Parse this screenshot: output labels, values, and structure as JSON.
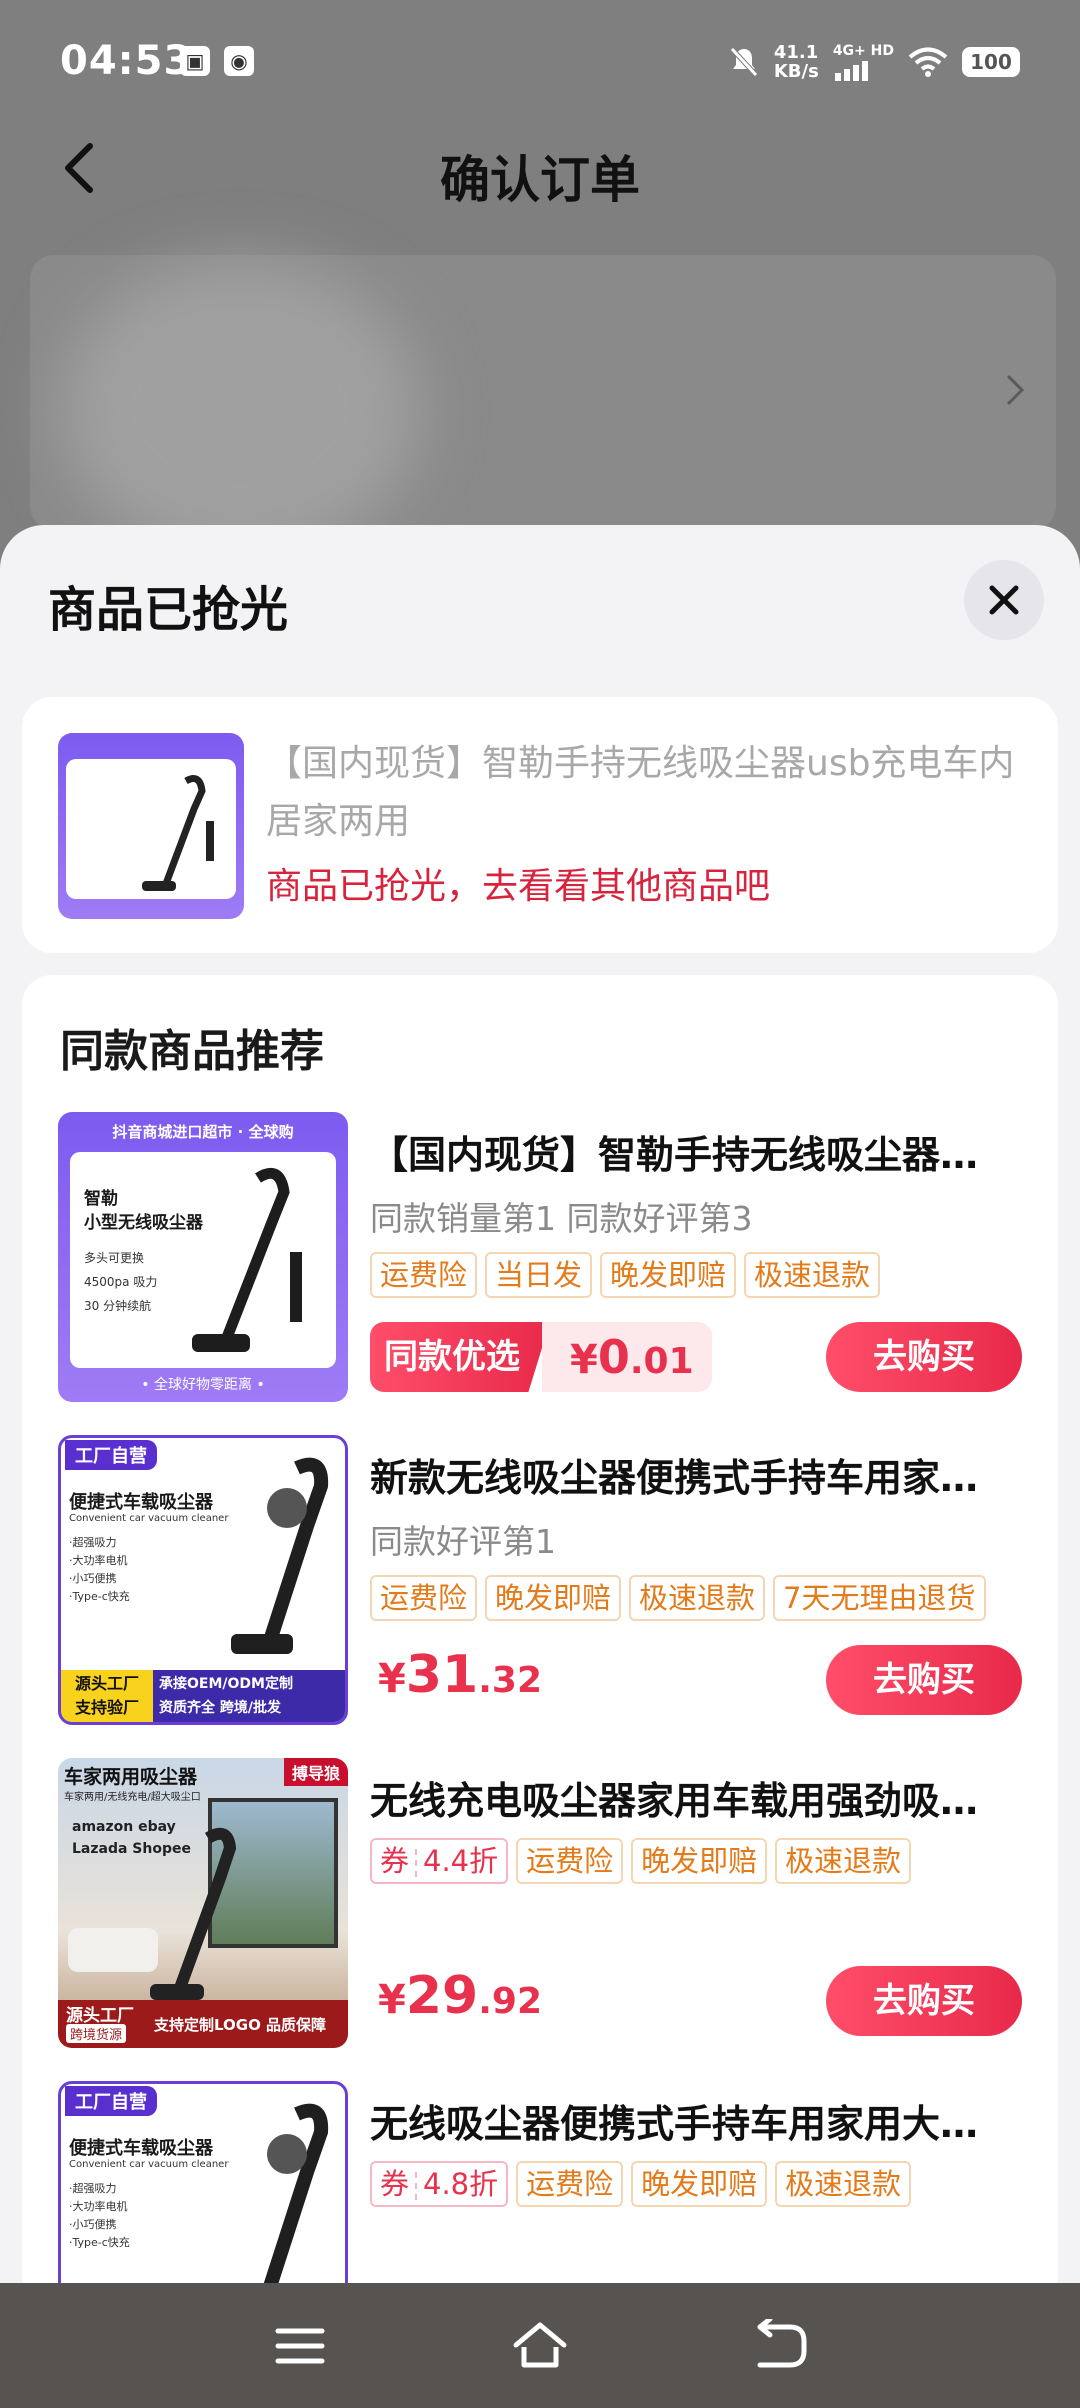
{
  "status_bar": {
    "time": "04:53",
    "net_speed_value": "41.1",
    "net_speed_unit": "KB/s",
    "network": "4G+ HD",
    "battery": "100"
  },
  "header": {
    "title": "确认订单"
  },
  "sheet": {
    "title": "商品已抢光",
    "soldout": {
      "name": "【国内现货】智勒手持无线吸尘器usb充电车内居家两用",
      "message": "商品已抢光，去看看其他商品吧"
    },
    "recommend_title": "同款商品推荐",
    "items": [
      {
        "name": "【国内现货】智勒手持无线吸尘器…",
        "sub": "同款销量第1 同款好评第3",
        "tags": [
          "运费险",
          "当日发",
          "晚发即赔",
          "极速退款"
        ],
        "promo": "同款优选",
        "price_yen": "¥",
        "price_int": "0",
        "price_dec": ".01",
        "buy": "去购买",
        "image_banner": "抖音商城进口超市 · 全球购",
        "image_label1": "智勒",
        "image_label2": "小型无线吸尘器",
        "image_points": [
          "多头可更换",
          "4500pa 吸力",
          "30 分钟续航"
        ],
        "image_foot": "• 全球好物零距离 •"
      },
      {
        "name": "新款无线吸尘器便携式手持车用家…",
        "sub": "同款好评第1",
        "tags": [
          "运费险",
          "晚发即赔",
          "极速退款",
          "7天无理由退货"
        ],
        "price_yen": "¥",
        "price_int": "31",
        "price_dec": ".32",
        "buy": "去购买",
        "image_badge": "工厂自营",
        "image_title": "便捷式车载吸尘器",
        "image_en": "Convenient car vacuum cleaner",
        "image_points": [
          "·超强吸力",
          "·大功率电机",
          "·小巧便携",
          "·Type-c快充"
        ],
        "image_foot1": "源头工厂",
        "image_foot2": "支持验厂",
        "image_foot3": "承接OEM/ODM定制",
        "image_foot4": "资质齐全  跨境/批发"
      },
      {
        "name": "无线充电吸尘器家用车载用强劲吸…",
        "coupon": "券",
        "coupon_value": "4.4折",
        "tags": [
          "运费险",
          "晚发即赔",
          "极速退款"
        ],
        "price_yen": "¥",
        "price_int": "29",
        "price_dec": ".92",
        "buy": "去购买",
        "image_title": "车家两用吸尘器",
        "image_brand": "搏导狼",
        "image_sub": "车家两用/无线充电/超大吸尘口",
        "image_shops": [
          "amazon ebay",
          "Lazada Shopee"
        ],
        "image_foot1": "源头工厂",
        "image_foot2": "跨境货源",
        "image_foot3": "支持定制LOGO 品质保障"
      },
      {
        "name": "无线吸尘器便携式手持车用家用大…",
        "coupon": "券",
        "coupon_value": "4.8折",
        "tags": [
          "运费险",
          "晚发即赔",
          "极速退款"
        ],
        "image_badge": "工厂自营",
        "image_title": "便捷式车载吸尘器",
        "image_en": "Convenient car vacuum cleaner",
        "image_points": [
          "·超强吸力",
          "·大功率电机",
          "·小巧便携",
          "·Type-c快充"
        ]
      }
    ]
  },
  "colors": {
    "accent": "#e8324d",
    "tag_text": "#e37b1b",
    "tag_border": "#f5d6b3",
    "sheet_bg": "#f3f3f5",
    "overlay": "#7f7f7f"
  },
  "icons": {
    "back": "chevron-left-icon",
    "close": "close-icon",
    "nav_menu": "menu-icon",
    "nav_home": "home-icon",
    "nav_back": "back-arrow-icon"
  }
}
